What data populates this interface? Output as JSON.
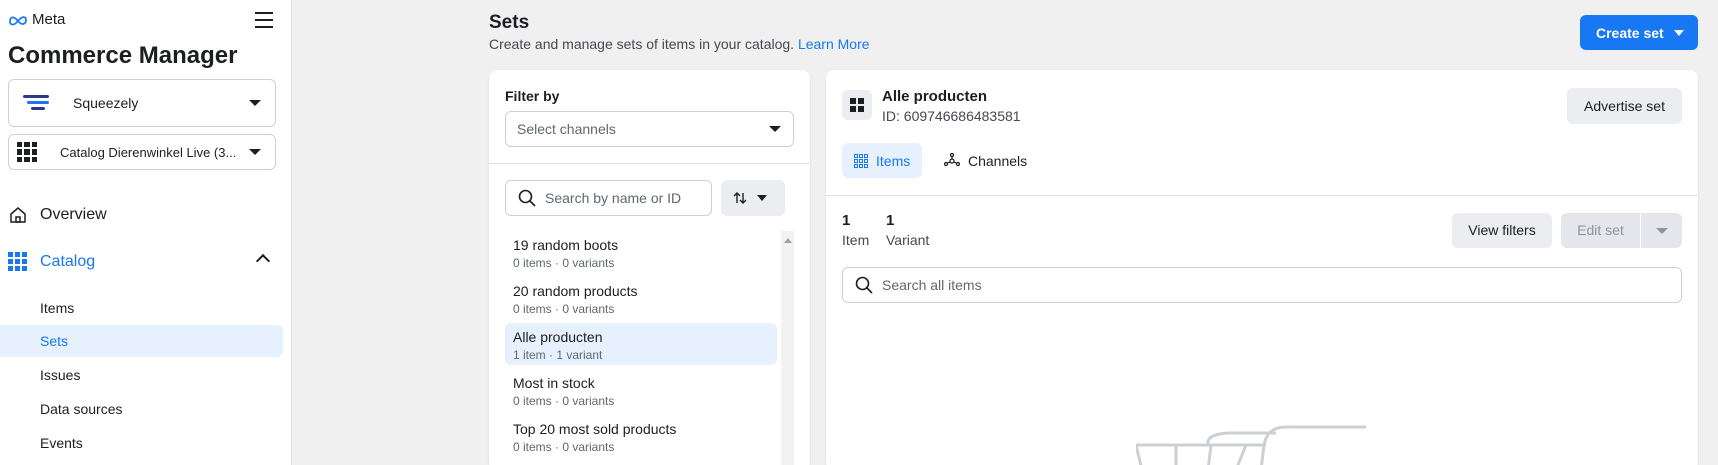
{
  "brand": {
    "logo_text": "Meta",
    "app_title": "Commerce Manager"
  },
  "sidebar": {
    "business": "Squeezely",
    "catalog": "Catalog Dierenwinkel Live (3...",
    "nav": [
      {
        "label": "Overview",
        "icon": "home-icon"
      },
      {
        "label": "Catalog",
        "icon": "catalog-grid-icon"
      }
    ],
    "catalog_items": [
      {
        "label": "Items",
        "active": false
      },
      {
        "label": "Sets",
        "active": true
      },
      {
        "label": "Issues",
        "active": false
      },
      {
        "label": "Data sources",
        "active": false
      },
      {
        "label": "Events",
        "active": false
      }
    ]
  },
  "header": {
    "title": "Sets",
    "description": "Create and manage sets of items in your catalog.",
    "learn_more": "Learn More",
    "create_button": "Create set"
  },
  "filter_panel": {
    "filter_label": "Filter by",
    "channel_placeholder": "Select channels",
    "search_placeholder": "Search by name or ID",
    "sets": [
      {
        "name": "19 random boots",
        "meta": "0 items · 0 variants",
        "active": false
      },
      {
        "name": "20 random products",
        "meta": "0 items · 0 variants",
        "active": false
      },
      {
        "name": "Alle producten",
        "meta": "1 item · 1 variant",
        "active": true
      },
      {
        "name": "Most in stock",
        "meta": "0 items · 0 variants",
        "active": false
      },
      {
        "name": "Top 20 most sold products",
        "meta": "0 items · 0 variants",
        "active": false
      }
    ]
  },
  "detail": {
    "name": "Alle producten",
    "id": "ID: 609746686483581",
    "advertise_button": "Advertise set",
    "tabs": [
      {
        "label": "Items",
        "active": true
      },
      {
        "label": "Channels",
        "active": false
      }
    ],
    "item_count": "1",
    "item_label": "Item",
    "variant_count": "1",
    "variant_label": "Variant",
    "view_filters": "View filters",
    "edit_set": "Edit set",
    "search_placeholder": "Search all items"
  },
  "colors": {
    "accent": "#1877f2",
    "active_bg": "#e7f0fd"
  }
}
